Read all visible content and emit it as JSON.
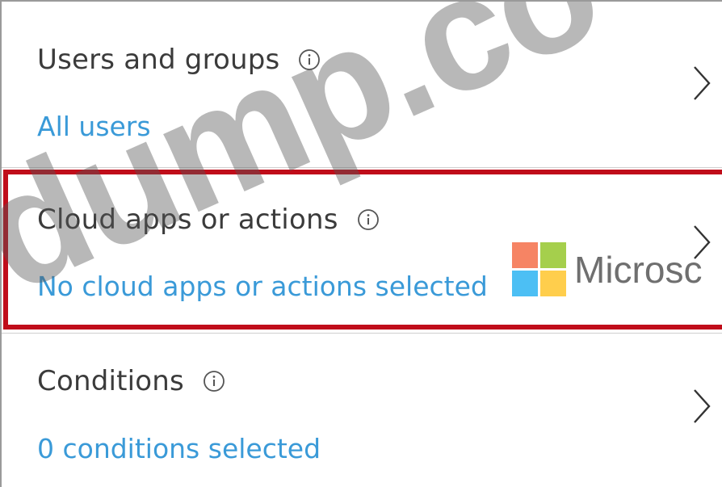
{
  "rows": [
    {
      "title": "Users and groups",
      "subtitle": "All users"
    },
    {
      "title": "Cloud apps or actions",
      "subtitle": "No cloud apps or actions selected"
    },
    {
      "title": "Conditions",
      "subtitle": "0 conditions selected"
    }
  ],
  "watermark": {
    "text": "rdump.co",
    "logo_text": "Microsc"
  },
  "colors": {
    "title_text": "#3b3b3b",
    "link_text": "#3a9ad8",
    "highlight_border": "#c00d1a",
    "logo_red": "#f25022",
    "logo_green": "#7fba00",
    "logo_blue": "#00a4ef",
    "logo_yellow": "#ffb900"
  },
  "icons": {
    "info": "info-circle-icon",
    "chevron": "chevron-right-icon"
  }
}
